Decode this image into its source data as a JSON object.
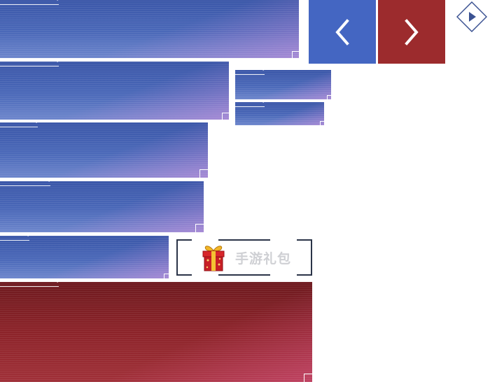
{
  "nav": {
    "prev_icon": "chevron-left-icon",
    "next_icon": "chevron-right-icon",
    "toggle_icon": "play-triangle-icon",
    "prev_color": "#4466c2",
    "next_color": "#9c2b2d"
  },
  "gift": {
    "label": "手游礼包",
    "icon": "gift-box-icon"
  },
  "colors": {
    "panel_blue": "#4a68b8",
    "panel_red": "#8c2329",
    "frame_dark": "#2b3448",
    "label_gray": "#cfd0d4"
  }
}
